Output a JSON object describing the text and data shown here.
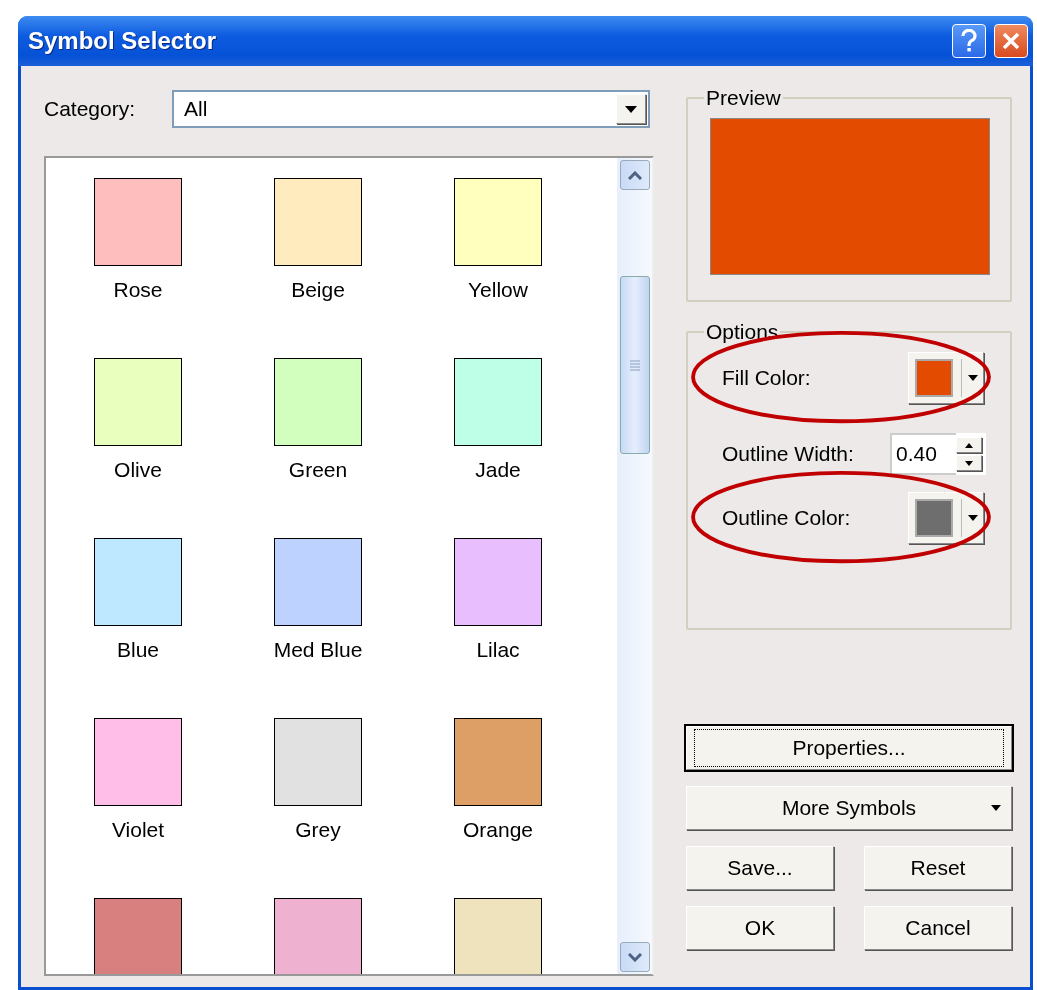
{
  "window": {
    "title": "Symbol Selector"
  },
  "category": {
    "label": "Category:",
    "value": "All"
  },
  "symbols": [
    {
      "name": "Rose",
      "color": "#ffbebe"
    },
    {
      "name": "Beige",
      "color": "#ffebbe"
    },
    {
      "name": "Yellow",
      "color": "#ffffbe"
    },
    {
      "name": "Olive",
      "color": "#e9ffbe"
    },
    {
      "name": "Green",
      "color": "#d3ffbe"
    },
    {
      "name": "Jade",
      "color": "#beffe8"
    },
    {
      "name": "Blue",
      "color": "#bee8ff"
    },
    {
      "name": "Med Blue",
      "color": "#bed2ff"
    },
    {
      "name": "Lilac",
      "color": "#e8beff"
    },
    {
      "name": "Violet",
      "color": "#ffbee8"
    },
    {
      "name": "Grey",
      "color": "#e1e1e1"
    },
    {
      "name": "Orange",
      "color": "#de9f66"
    },
    {
      "color": "#d7807f"
    },
    {
      "color": "#efb1d0"
    },
    {
      "color": "#efe3be"
    }
  ],
  "preview": {
    "title": "Preview",
    "color": "#e34c00"
  },
  "options": {
    "title": "Options",
    "rows": [
      {
        "kind": "color",
        "label": "Fill Color:",
        "color": "#e34c00",
        "highlighted": true
      },
      {
        "kind": "number",
        "label": "Outline Width:",
        "value": "0.40",
        "highlighted": false
      },
      {
        "kind": "color",
        "label": "Outline Color:",
        "color": "#6e6e6e",
        "highlighted": true
      }
    ]
  },
  "buttons": [
    {
      "label": "Properties...",
      "kind": "wide",
      "focused": true
    },
    {
      "label": "More Symbols",
      "kind": "menu",
      "focused": false
    },
    {
      "label": "Save...",
      "kind": "half",
      "focused": false
    },
    {
      "label": "Reset",
      "kind": "half",
      "focused": false
    },
    {
      "label": "OK",
      "kind": "half",
      "focused": false
    },
    {
      "label": "Cancel",
      "kind": "half",
      "focused": false
    }
  ]
}
